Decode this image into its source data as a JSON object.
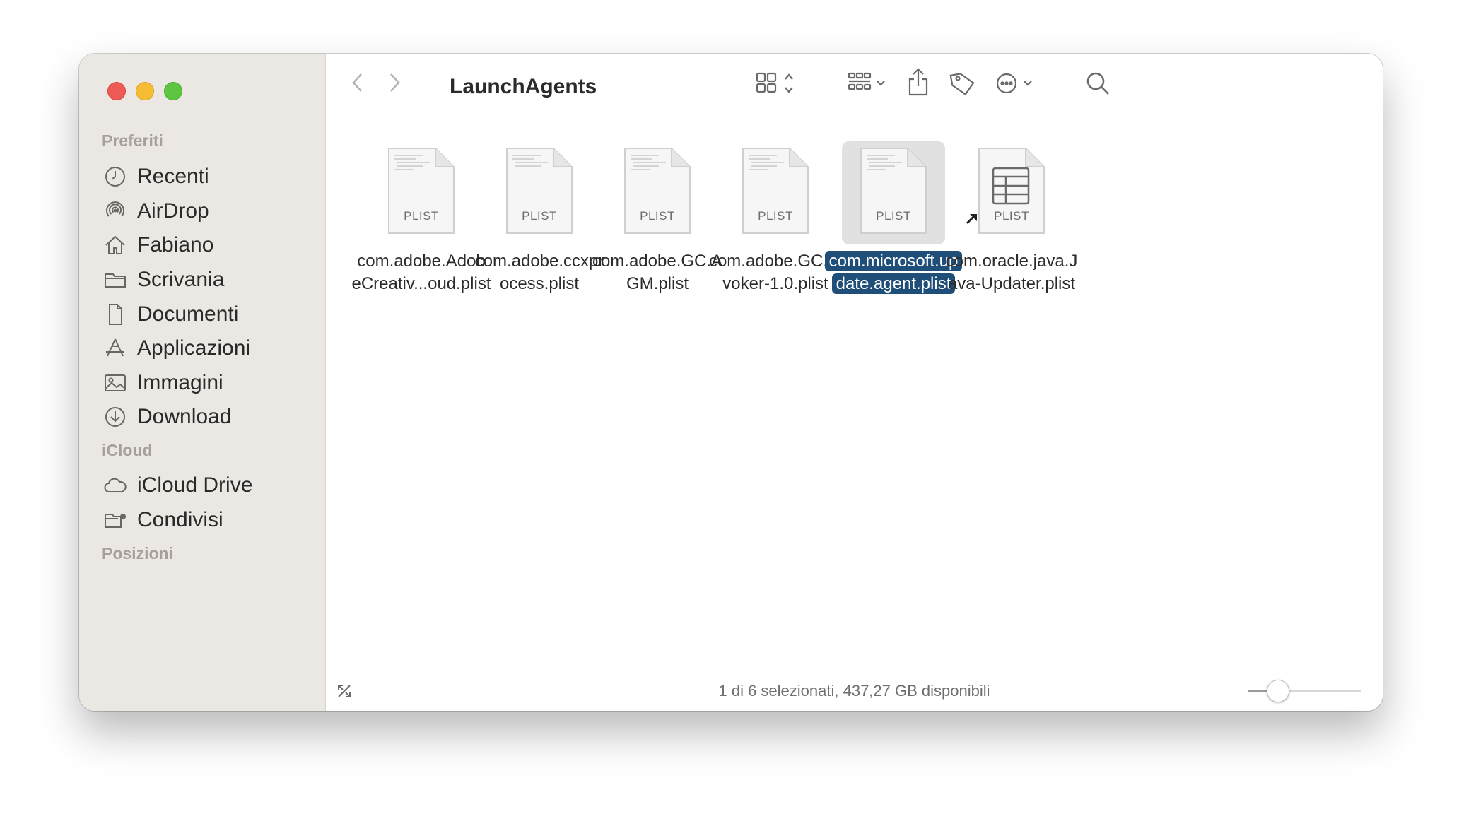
{
  "window": {
    "folder_title": "LaunchAgents"
  },
  "sidebar": {
    "sections": [
      {
        "header": "Preferiti"
      },
      {
        "header": "iCloud"
      },
      {
        "header": "Posizioni"
      }
    ],
    "favorites": [
      {
        "label": "Recenti",
        "icon": "clock-icon"
      },
      {
        "label": "AirDrop",
        "icon": "airdrop-icon"
      },
      {
        "label": "Fabiano",
        "icon": "home-icon"
      },
      {
        "label": "Scrivania",
        "icon": "desktop-folder-icon"
      },
      {
        "label": "Documenti",
        "icon": "document-icon"
      },
      {
        "label": "Applicazioni",
        "icon": "applications-icon"
      },
      {
        "label": "Immagini",
        "icon": "photo-icon"
      },
      {
        "label": "Download",
        "icon": "download-icon"
      }
    ],
    "icloud": [
      {
        "label": "iCloud Drive",
        "icon": "cloud-icon"
      },
      {
        "label": "Condivisi",
        "icon": "shared-folder-icon"
      }
    ]
  },
  "files": [
    {
      "name": "com.adobe.Adob\neCreativ...oud.plist",
      "ext": "PLIST",
      "selected": false
    },
    {
      "name": "com.adobe.ccxpr\nocess.plist",
      "ext": "PLIST",
      "selected": false
    },
    {
      "name": "com.adobe.GC.A\nGM.plist",
      "ext": "PLIST",
      "selected": false
    },
    {
      "name": "com.adobe.GC.In\nvoker-1.0.plist",
      "ext": "PLIST",
      "selected": false
    },
    {
      "name": "com.microsoft.up\ndate.agent.plist",
      "ext": "PLIST",
      "selected": true
    },
    {
      "name": "com.oracle.java.J\nava-Updater.plist",
      "ext": "PLIST",
      "selected": false,
      "alias": true
    }
  ],
  "status": {
    "text": "1 di 6 selezionati, 437,27 GB disponibili",
    "icon_size_level": 0.2
  },
  "colors": {
    "selection": "#1f4e79",
    "close": "#ee5b56",
    "minimize": "#f6bd34",
    "zoom": "#5ec540"
  }
}
